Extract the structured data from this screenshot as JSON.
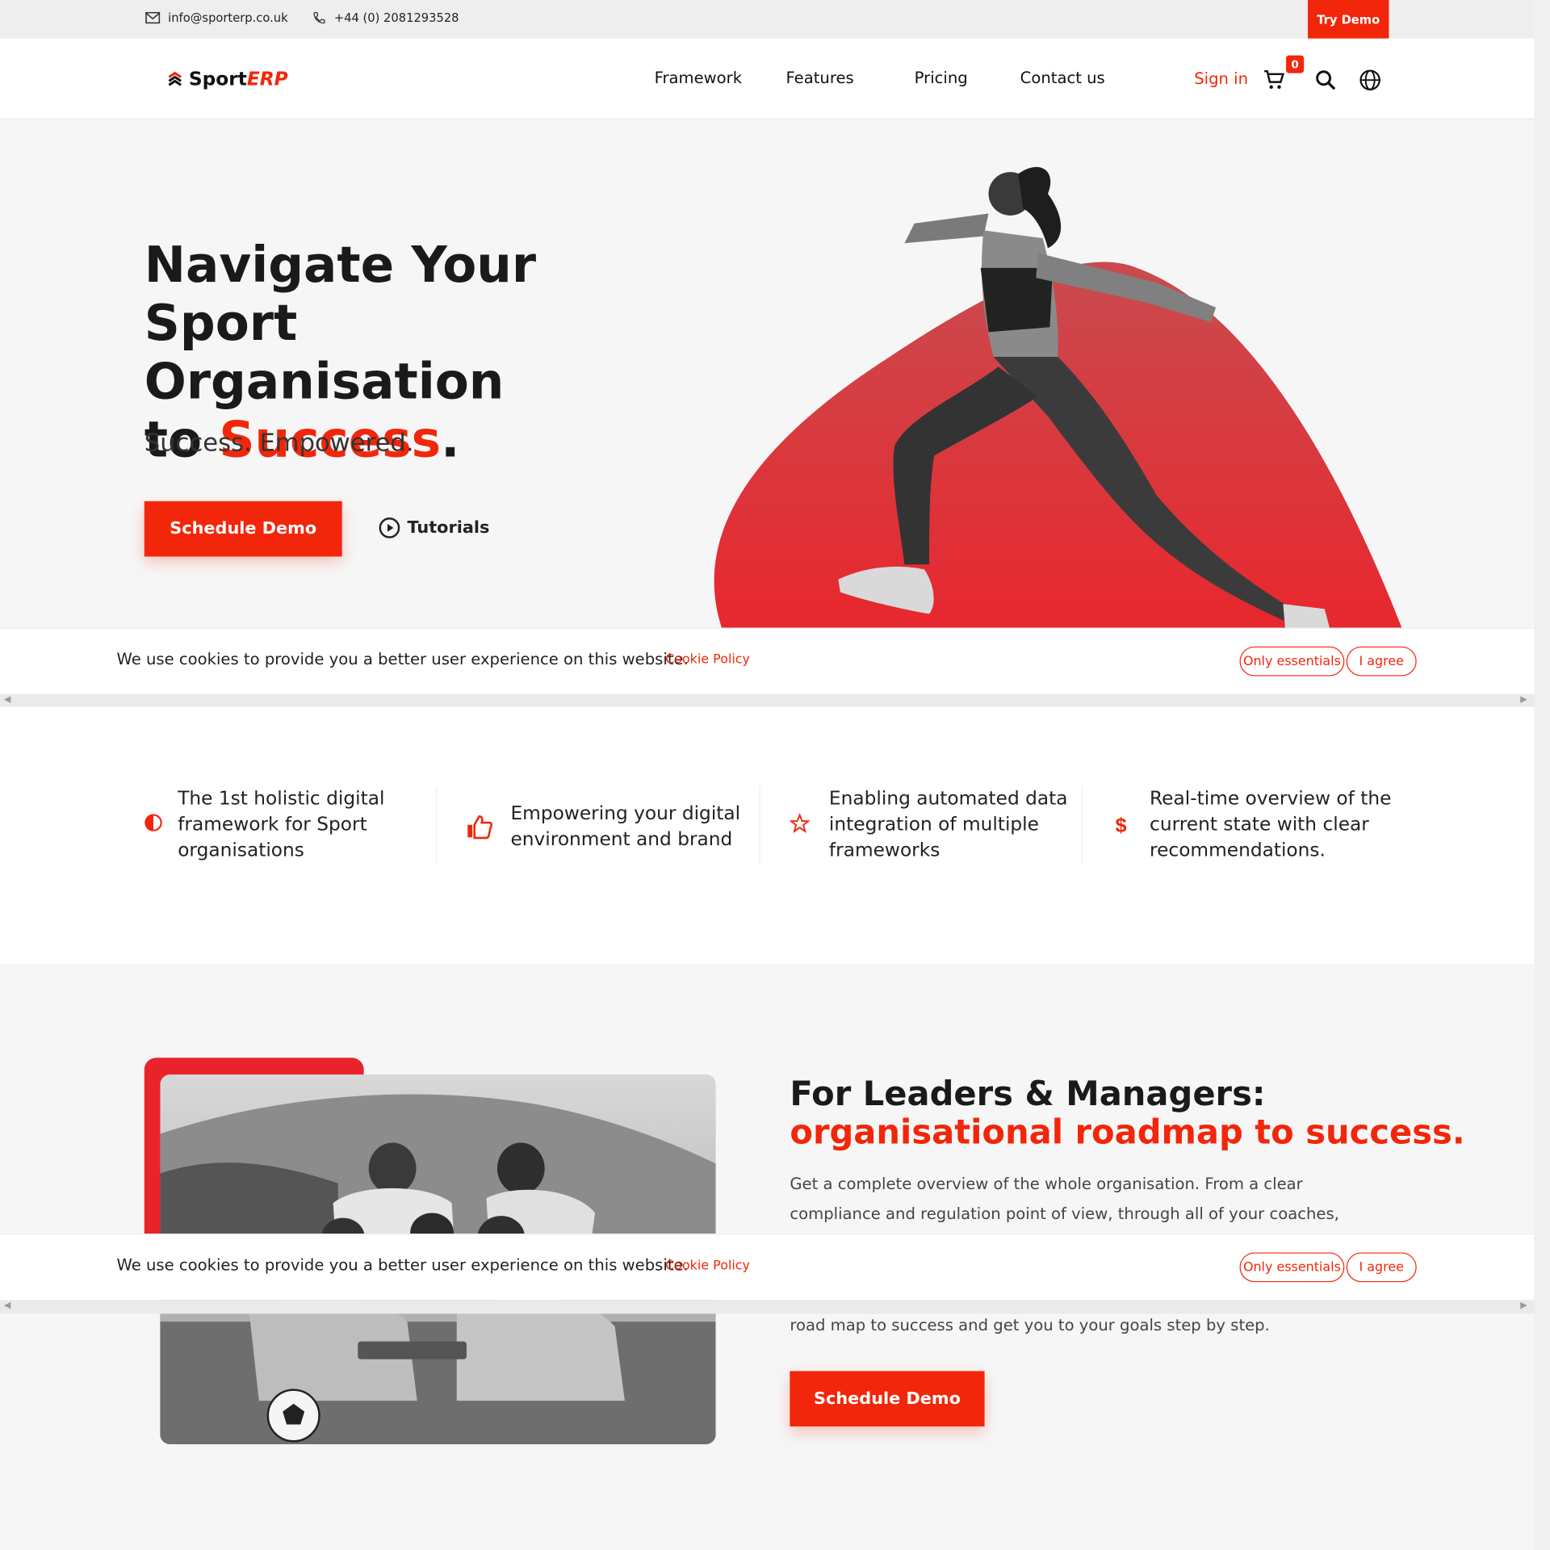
{
  "topbar": {
    "email": "info@sporterp.co.uk",
    "phone": "+44 (0) 2081293528",
    "try_demo": "Try Demo"
  },
  "nav": {
    "logo_sport": "Sport",
    "logo_erp": "ERP",
    "links": [
      "Framework",
      "Features",
      "Pricing",
      "Contact us"
    ],
    "signin": "Sign in",
    "cart_count": "0"
  },
  "hero": {
    "title_line1": "Navigate Your",
    "title_line2": "Sport Organisation",
    "title_to": "to ",
    "title_accent": "Success",
    "title_dot": ".",
    "subtitle": "Success. Empowered.",
    "cta": "Schedule Demo",
    "tutorials": "Tutorials"
  },
  "cookie": {
    "message": "We use cookies to provide you a better user experience on this website.",
    "policy": "Cookie Policy",
    "essentials": "Only essentials",
    "agree": "I agree"
  },
  "features": [
    {
      "text": "The 1st holistic digital framework for Sport organisations",
      "icon": "half-circle-icon"
    },
    {
      "text": "Empowering your digital environment and brand",
      "icon": "thumbs-up-icon"
    },
    {
      "text": "Enabling automated data integration of multiple frameworks",
      "icon": "star-icon"
    },
    {
      "text": "Real-time overview of the current state with clear recommendations.",
      "icon": "dollar-icon"
    }
  ],
  "leaders": {
    "title_line1": "For Leaders & Managers:",
    "title_line2": "organisational roadmap to success.",
    "body": "Get a complete overview of the whole organisation. From a clear compliance and regulation point of view, through all of your coaches,",
    "body2": "road map to success and get you to your goals step by step.",
    "cta": "Schedule Demo"
  },
  "colors": {
    "accent": "#f2260a",
    "blob": "#e0333a"
  }
}
